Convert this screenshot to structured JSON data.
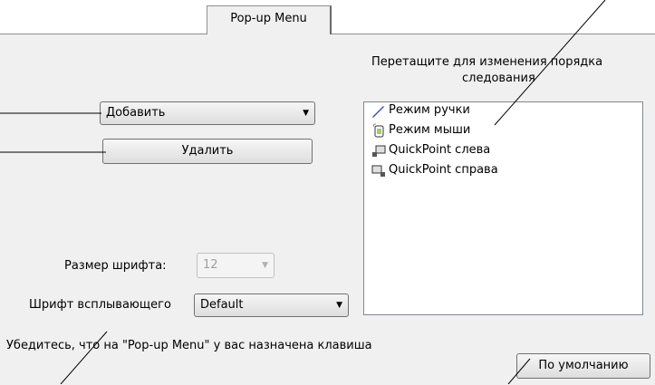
{
  "tab": {
    "label": "Pop-up Menu"
  },
  "add_combo": {
    "value": "Добавить"
  },
  "delete_button": {
    "label": "Удалить"
  },
  "order_hint": {
    "line1": "Перетащите для изменения порядка",
    "line2": "следования"
  },
  "popup_list": {
    "items": [
      {
        "label": "Режим  ручки",
        "icon": "pen-icon"
      },
      {
        "label": "Режим  мыши",
        "icon": "mouse-icon"
      },
      {
        "label": "QuickPoint слева",
        "icon": "quickpoint-left-icon"
      },
      {
        "label": "QuickPoint справа",
        "icon": "quickpoint-right-icon"
      }
    ]
  },
  "font_size": {
    "label": "Размер шрифта:",
    "value": "12"
  },
  "popup_font": {
    "label": "Шрифт всплывающего",
    "value": "Default"
  },
  "note": {
    "text": "Убедитесь, что на \"Pop-up Menu\" у вас назначена клавиша"
  },
  "default_button": {
    "label": "По умолчанию"
  }
}
